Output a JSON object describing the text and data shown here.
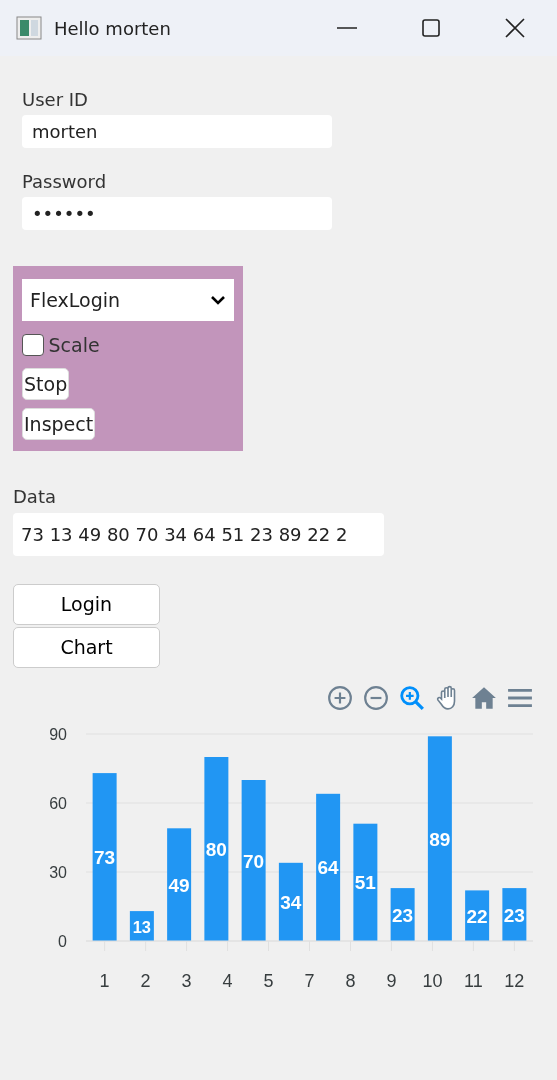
{
  "window": {
    "title": "Hello morten"
  },
  "fields": [
    {
      "label": "User ID",
      "value": "morten"
    },
    {
      "label": "Password",
      "value": "••••••"
    }
  ],
  "panel": {
    "dropdown": {
      "value": "FlexLogin"
    },
    "checkbox": {
      "label": "Scale",
      "checked": false
    },
    "buttons": [
      "Stop",
      "Inspect"
    ]
  },
  "data_field": {
    "label": "Data",
    "value": "73 13 49 80 70 34 64 51 23 89 22 2"
  },
  "buttons": [
    "Login",
    "Chart"
  ],
  "chart": {
    "toolbar": [
      {
        "kind": "zoom-in",
        "selected": false
      },
      {
        "kind": "zoom-out",
        "selected": false
      },
      {
        "kind": "zoom",
        "selected": true
      },
      {
        "kind": "pan",
        "selected": false
      },
      {
        "kind": "home",
        "selected": false
      },
      {
        "kind": "menu",
        "selected": false
      }
    ],
    "chart_data": {
      "type": "bar",
      "x": [
        1,
        2,
        3,
        4,
        5,
        6,
        7,
        8,
        9,
        10,
        11,
        12
      ],
      "series": [
        {
          "color": "#2196f3",
          "values": [
            73,
            13,
            49,
            80,
            70,
            34,
            64,
            51,
            23,
            89,
            22,
            23
          ]
        }
      ],
      "xlim": [
        0.5,
        12.5
      ],
      "ylim": [
        0,
        90
      ],
      "yticks": [
        0,
        30,
        60,
        90
      ],
      "xticks": [
        {
          "value": 1,
          "label": "1"
        },
        {
          "value": 2.1,
          "label": "2"
        },
        {
          "value": 3.2,
          "label": "3"
        },
        {
          "value": 4.3,
          "label": "4"
        },
        {
          "value": 5.4,
          "label": "5"
        },
        {
          "value": 6.5,
          "label": "7"
        },
        {
          "value": 7.6,
          "label": "8"
        },
        {
          "value": 8.7,
          "label": "9"
        },
        {
          "value": 9.8,
          "label": "10"
        },
        {
          "value": 10.9,
          "label": "11"
        },
        {
          "value": 12,
          "label": "12"
        }
      ],
      "data_labels": true
    }
  }
}
